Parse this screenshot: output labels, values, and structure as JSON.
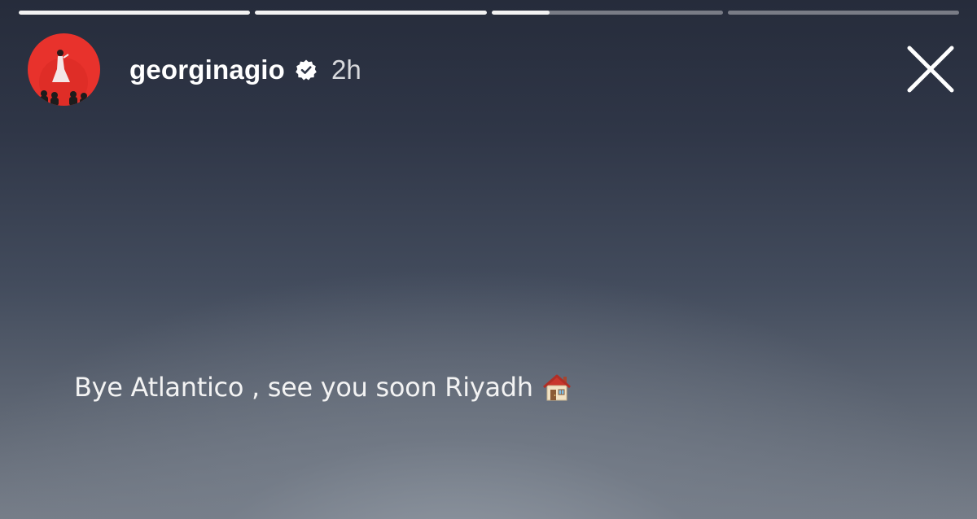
{
  "story": {
    "segments": [
      {
        "progress": 1.0
      },
      {
        "progress": 1.0
      },
      {
        "progress": 0.25
      },
      {
        "progress": 0.0
      }
    ]
  },
  "header": {
    "avatar_icon": "profile-photo",
    "username": "georginagio",
    "verified_icon": "verified-badge-icon",
    "time_ago": "2h",
    "close_icon": "close-icon"
  },
  "caption": {
    "text": "Bye Atlantico , see you soon Riyadh",
    "emoji_icon": "house-icon"
  },
  "colors": {
    "accent_red": "#e8322c",
    "text": "#ffffff"
  }
}
